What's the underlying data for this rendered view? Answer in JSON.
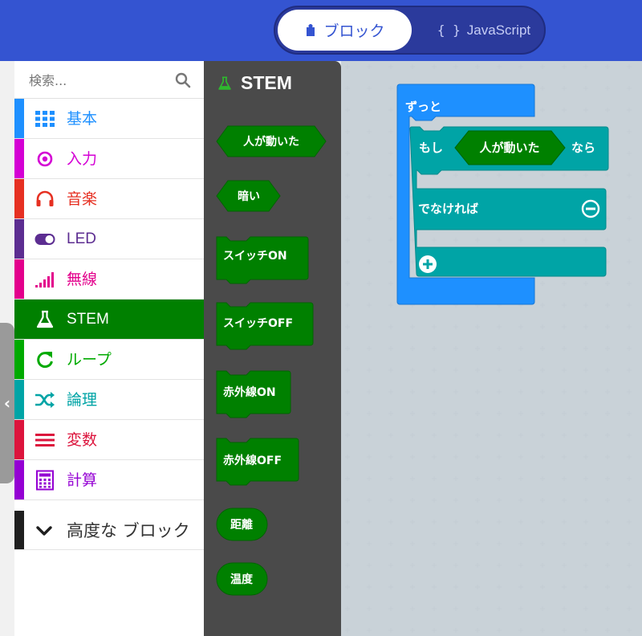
{
  "toggle": {
    "blocks_label": "ブロック",
    "js_label": "JavaScript",
    "js_icon": "{ }"
  },
  "search": {
    "placeholder": "検索..."
  },
  "categories": [
    {
      "label": "基本",
      "color": "#1e90ff",
      "icon": "grid-icon"
    },
    {
      "label": "入力",
      "color": "#d400d4",
      "icon": "input-target-icon"
    },
    {
      "label": "音楽",
      "color": "#e63022",
      "icon": "headphones-icon"
    },
    {
      "label": "LED",
      "color": "#5c2d91",
      "icon": "toggle-icon"
    },
    {
      "label": "無線",
      "color": "#e3008c",
      "icon": "signal-bars-icon"
    },
    {
      "label": "STEM",
      "color": "#008000",
      "icon": "flask-icon"
    },
    {
      "label": "ループ",
      "color": "#00aa00",
      "icon": "loop-arrow-icon"
    },
    {
      "label": "論理",
      "color": "#00a4a6",
      "icon": "shuffle-icon"
    },
    {
      "label": "変数",
      "color": "#dc143c",
      "icon": "lines-icon"
    },
    {
      "label": "計算",
      "color": "#9400d3",
      "icon": "calculator-icon"
    }
  ],
  "advanced": {
    "label": "高度な ブロック"
  },
  "flyout": {
    "title": "STEM",
    "blocks": [
      {
        "label": "人が動いた",
        "shape": "hexagon"
      },
      {
        "label": "暗い",
        "shape": "hexagon"
      },
      {
        "label": "スイッチON",
        "shape": "statement"
      },
      {
        "label": "スイッチOFF",
        "shape": "statement"
      },
      {
        "label": "赤外線ON",
        "shape": "statement"
      },
      {
        "label": "赤外線OFF",
        "shape": "statement"
      },
      {
        "label": "距離",
        "shape": "round"
      },
      {
        "label": "温度",
        "shape": "round"
      }
    ]
  },
  "workspace": {
    "forever_label": "ずっと",
    "if_label": "もし",
    "condition_label": "人が動いた",
    "then_label": "なら",
    "else_label": "でなければ"
  },
  "colors": {
    "topbar": "#3454d1",
    "stem_green": "#008000",
    "forever_blue": "#1e90ff",
    "logic_teal": "#00a4a6",
    "flyout_bg": "#4a4a4a"
  }
}
